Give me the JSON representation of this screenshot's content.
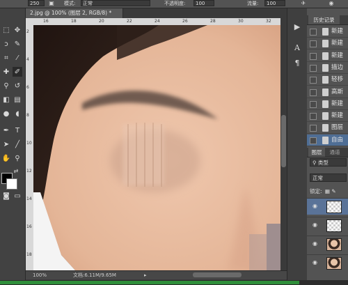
{
  "options_bar": {
    "brush_size": "250",
    "mode_label": "模式:",
    "mode_value": "正常",
    "opacity_label": "不透明度:",
    "opacity_value": "100",
    "flow_label": "流量:",
    "flow_value": "100"
  },
  "document": {
    "tab_title": "2.jpg @ 100% (图层 2, RGB/8) *",
    "zoom": "100%",
    "doc_size": "文档:6.11M/9.65M"
  },
  "ruler": {
    "top_ticks": [
      "16",
      "18",
      "20",
      "22",
      "24",
      "26",
      "28",
      "30",
      "32"
    ],
    "left_ticks": [
      "2",
      "4",
      "6",
      "8",
      "10",
      "12",
      "14",
      "16",
      "18"
    ]
  },
  "history": {
    "title": "历史记录",
    "items": [
      {
        "label": "新建",
        "selected": false
      },
      {
        "label": "新建",
        "selected": false
      },
      {
        "label": "新建",
        "selected": false
      },
      {
        "label": "描边",
        "selected": false
      },
      {
        "label": "轻移",
        "selected": false
      },
      {
        "label": "高斯",
        "selected": false
      },
      {
        "label": "新建",
        "selected": false
      },
      {
        "label": "新建",
        "selected": false
      },
      {
        "label": "图层",
        "selected": false
      },
      {
        "label": "自由",
        "selected": true
      }
    ]
  },
  "layers": {
    "tab_layers": "图层",
    "tab_channels": "通道",
    "filter_label": "类型",
    "blend_mode": "正常",
    "lock_label": "锁定:",
    "rows": [
      {
        "thumb": "checker",
        "selected": true
      },
      {
        "thumb": "checker",
        "selected": false
      },
      {
        "thumb": "face",
        "selected": false
      },
      {
        "thumb": "face",
        "selected": false
      }
    ]
  },
  "progress_fraction": 0.86
}
